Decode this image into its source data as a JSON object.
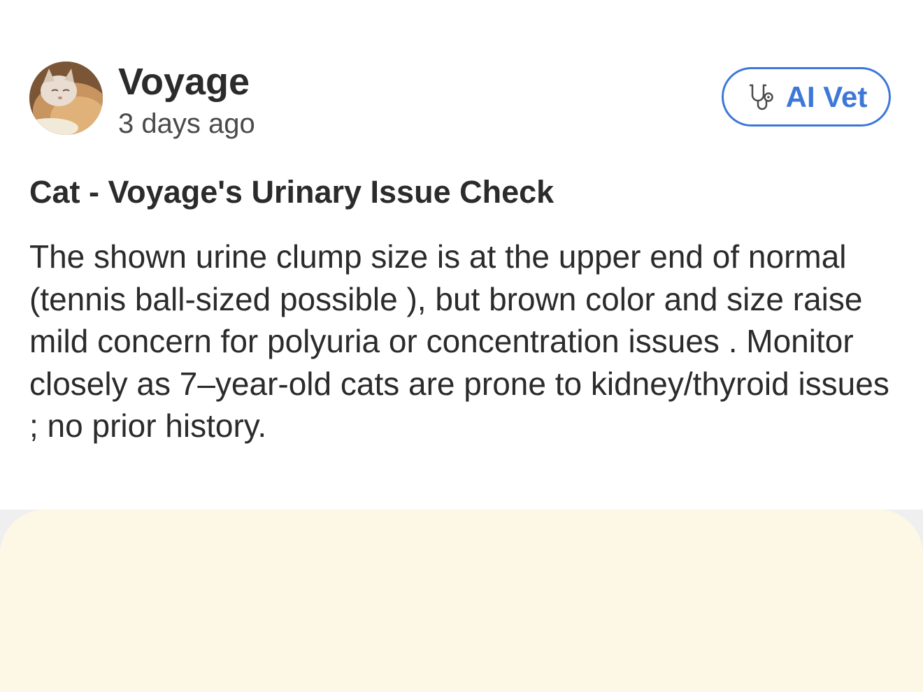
{
  "post": {
    "user_name": "Voyage",
    "timestamp": "3 days ago",
    "title": "Cat - Voyage's Urinary Issue Check",
    "body": "The shown urine clump size is at the upper end of normal (tennis ball-sized possible ), but brown color and size raise mild concern for polyuria or concentration issues . Monitor closely as 7–year-old cats are prone to kidney/thyroid issues ; no prior history."
  },
  "ai_vet_button": {
    "label": "AI Vet",
    "icon": "stethoscope-icon",
    "color": "#3d78d8"
  },
  "avatar": {
    "icon": "cat-photo-avatar"
  },
  "colors": {
    "text": "#2b2b2b",
    "accent": "#3d78d8",
    "card_background": "#fdf7e6"
  }
}
